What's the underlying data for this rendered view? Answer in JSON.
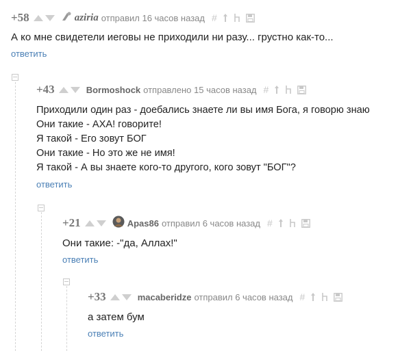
{
  "comments": [
    {
      "rating": "+58",
      "author": "aziria",
      "meta": "отправил 16 часов назад",
      "text": "А ко мне свидетели иеговы не приходили ни разу... грустно как-то...",
      "reply": "ответить"
    },
    {
      "rating": "+43",
      "author": "Bormoshock",
      "meta": "отправлено 15 часов назад",
      "text": "Приходили один раз - доебались знаете ли вы имя Бога, я говорю знаю\nОни такие - АХА! говорите!\nЯ такой - Его зовут БОГ\nОни такие - Но это же не имя!\nЯ такой - А вы знаете кого-то другого, кого зовут \"БОГ\"?",
      "reply": "ответить"
    },
    {
      "rating": "+21",
      "author": "Apas86",
      "meta": "отправил 6 часов назад",
      "text": "Они такие: -\"да, Аллах!\"",
      "reply": "ответить"
    },
    {
      "rating": "+33",
      "author": "macaberidze",
      "meta": "отправил 6 часов назад",
      "text": "а затем бум",
      "reply": "ответить"
    }
  ],
  "icons": {
    "link": "link-icon",
    "up_arrow": "arrow-up-icon",
    "parent_arrow": "parent-arrow-icon",
    "save": "save-icon"
  },
  "colors": {
    "link": "#4a7fb5",
    "muted": "#888888"
  }
}
